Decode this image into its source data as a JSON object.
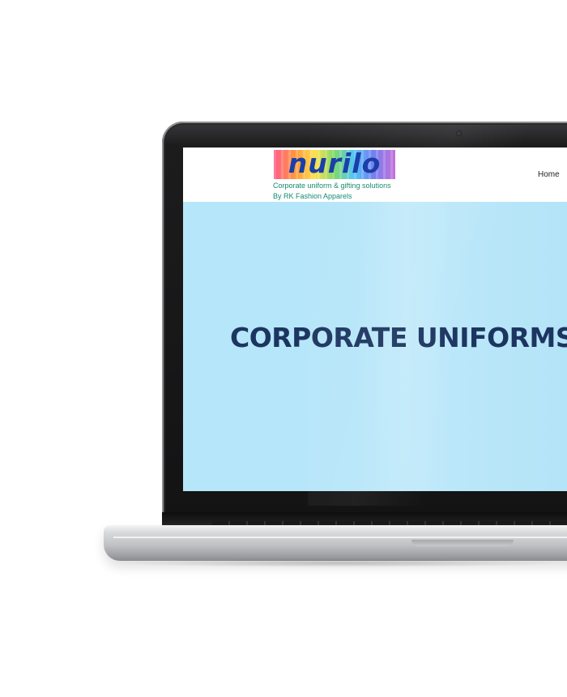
{
  "site": {
    "logo_text": "nurilo",
    "tagline": "Corporate uniform & gifting solutions",
    "byline": "By RK Fashion Apparels"
  },
  "nav": {
    "home_label": "Home"
  },
  "hero": {
    "title": "CORPORATE UNIFORMS"
  },
  "colors": {
    "hero_background": "#b6e6f9",
    "hero_title": "#1c3560",
    "tagline": "#138a6e",
    "logo_text": "#1a3fa8"
  }
}
